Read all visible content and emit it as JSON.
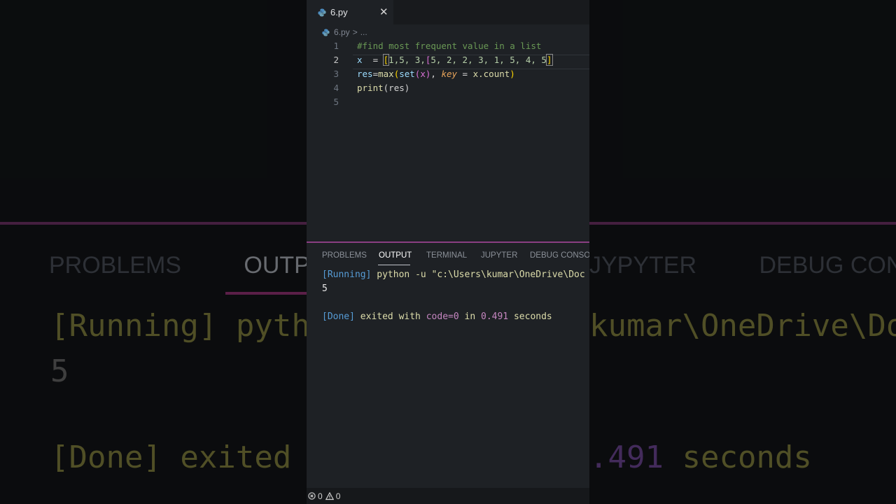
{
  "background": {
    "tabs": [
      "PROBLEMS",
      "OUTPUT"
    ],
    "right_tabs": [
      "JYPYTER",
      "DEBUG CONSOLE"
    ],
    "running_line": "[Running] pytho",
    "running_right": "kumar\\OneDrive\\Doc",
    "result": "5",
    "done_line_left": "[Done] exited w",
    "done_right_num": ".491",
    "done_right_text": "seconds"
  },
  "editor": {
    "tab_label": "6.py",
    "close_glyph": "✕",
    "breadcrumb_file": "6.py",
    "breadcrumb_sep": ">",
    "breadcrumb_more": "...",
    "line_numbers": [
      "1",
      "2",
      "3",
      "4",
      "5"
    ],
    "code": {
      "line1": "#find most frequent value in a list",
      "line2_var": "x",
      "line2_eq": "  = ",
      "line2_open": "[",
      "line2_vals": "1,5, 3,",
      "line2_inner_open": "[",
      "line2_rest": "5, 2, 2, 3, 1, 5, 4, 5",
      "line2_close": "]",
      "line3_var": "res",
      "line3_eq": "=",
      "line3_fn": "max",
      "line3_open": "(",
      "line3_set": "set",
      "line3_inner": "(x)",
      "line3_comma": ", ",
      "line3_key": "key",
      "line3_assign": " = ",
      "line3_count": "x.count",
      "line3_close": ")",
      "line4_fn": "print",
      "line4_args": "(res)"
    }
  },
  "panel": {
    "tabs": [
      "PROBLEMS",
      "OUTPUT",
      "TERMINAL",
      "JUPYTER",
      "DEBUG CONSOLE"
    ],
    "active_tab": "OUTPUT",
    "output": {
      "running_tag": "[Running]",
      "command": " python -u \"c:\\Users\\kumar\\OneDrive\\Doc",
      "result": "5",
      "done_tag": "[Done]",
      "exited_with": " exited with ",
      "code_label": "code=0",
      "in_label": " in ",
      "time": "0.491",
      "seconds": " seconds"
    }
  },
  "status_bar": {
    "errors": "0",
    "warnings": "0"
  },
  "colors": {
    "accent": "#8a3f83",
    "editor_bg": "#1e2125"
  }
}
